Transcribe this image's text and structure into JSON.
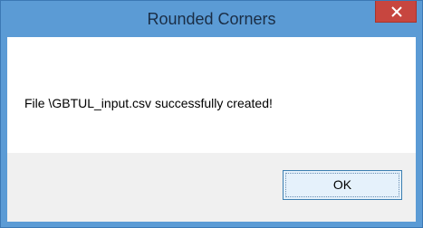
{
  "window": {
    "title": "Rounded Corners",
    "close_icon": "close-icon"
  },
  "dialog": {
    "message": "File \\GBTUL_input.csv successfully created!",
    "ok_label": "OK"
  },
  "colors": {
    "frame": "#5b9bd5",
    "close_button": "#c7463f",
    "button_area": "#f0f0f0",
    "ok_button_fill": "#e5f1fb",
    "ok_button_border": "#3c7fb1"
  }
}
